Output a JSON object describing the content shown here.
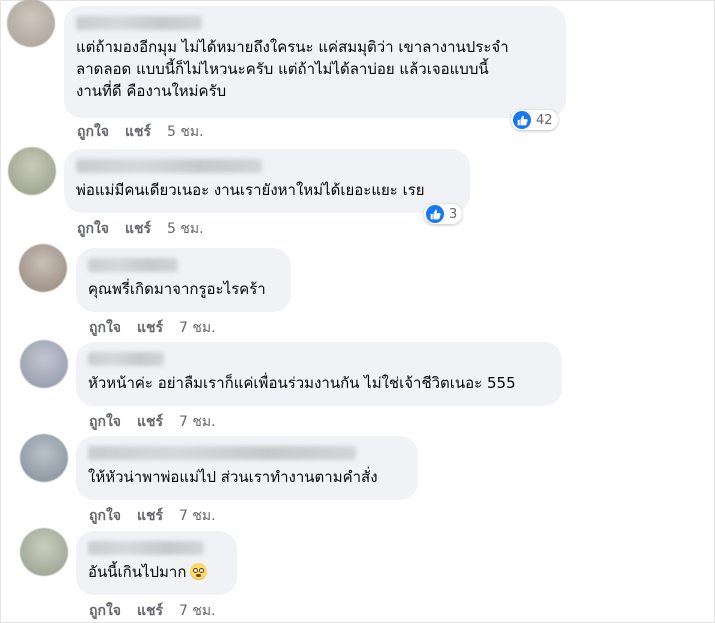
{
  "comments": [
    {
      "text": "แต่ถ้ามองอีกมุม ไม่ได้หมายถึงใครนะ แค่สมมุติว่า เขาลางานประจำ\nลาดลอด แบบนี้ก็ไม่ไหวนะครับ แต่ถ้าไม่ได้ลาบ่อย แล้วเจอแบบนี้\nงานที่ดี คืองานใหม่ครับ",
      "like_label": "ถูกใจ",
      "reply_label": "แชร์",
      "time": "5 ชม.",
      "reaction_count": "42"
    },
    {
      "text": "พ่อแม่มีคนเดียวเนอะ งานเรายังหาใหม่ได้เยอะแยะ เรย",
      "like_label": "ถูกใจ",
      "reply_label": "แชร์",
      "time": "5 ชม.",
      "reaction_count": "3"
    },
    {
      "text": "คุณพรี่เกิดมาจากรูอะไรคร้า",
      "like_label": "ถูกใจ",
      "reply_label": "แชร์",
      "time": "7 ชม."
    },
    {
      "text": "หัวหน้าค่ะ อย่าลืมเราก็แค่เพื่อนร่วมงานกัน ไม่ใช่เจ้าชีวิตเนอะ 555",
      "like_label": "ถูกใจ",
      "reply_label": "แชร์",
      "time": "7 ชม."
    },
    {
      "text": "ให้หัวน่าพาพ่อแม่ไป ส่วนเราทำงานตามคำสั่ง",
      "like_label": "ถูกใจ",
      "reply_label": "แชร์",
      "time": "7 ชม."
    },
    {
      "text": "อันนี้เกินไปมาก",
      "like_label": "ถูกใจ",
      "reply_label": "แชร์",
      "time": "7 ชม.",
      "emoji": "flushed-face-emoji"
    }
  ],
  "colors": {
    "bubble": "#f0f2f5",
    "like_blue": "#1877f2",
    "meta_gray": "#65676b"
  }
}
